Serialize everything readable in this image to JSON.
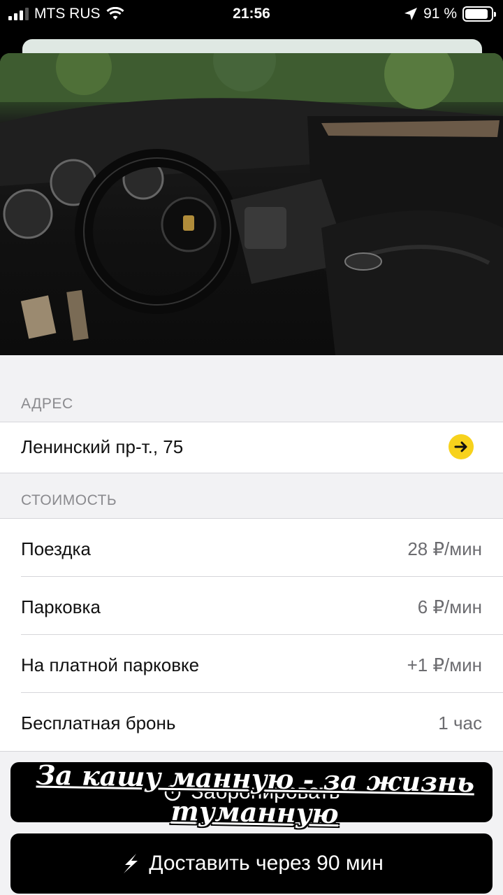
{
  "status_bar": {
    "carrier": "MTS RUS",
    "time": "21:56",
    "battery_percent": "91 %",
    "battery_level": 0.91
  },
  "gallery": {
    "photo_count": 7,
    "active_index": 5,
    "accent_color": "#f5cf1f"
  },
  "address": {
    "header": "АДРЕС",
    "value": "Ленинский пр-т., 75",
    "arrow_icon": "arrow-right-icon"
  },
  "cost": {
    "header": "СТОИМОСТЬ",
    "rows": [
      {
        "label": "Поездка",
        "value": "28 ₽/мин"
      },
      {
        "label": "Парковка",
        "value": "6 ₽/мин"
      },
      {
        "label": "На платной парковке",
        "value": "+1 ₽/мин"
      },
      {
        "label": "Бесплатная бронь",
        "value": "1 час"
      }
    ]
  },
  "buttons": {
    "book_label": "Забронировать",
    "book_icon": "timer-icon",
    "deliver_label": "Доставить через 90 мин",
    "deliver_icon": "lightning-icon"
  },
  "overlay": {
    "caption": "За кашу манную - за жизнь туманную"
  }
}
